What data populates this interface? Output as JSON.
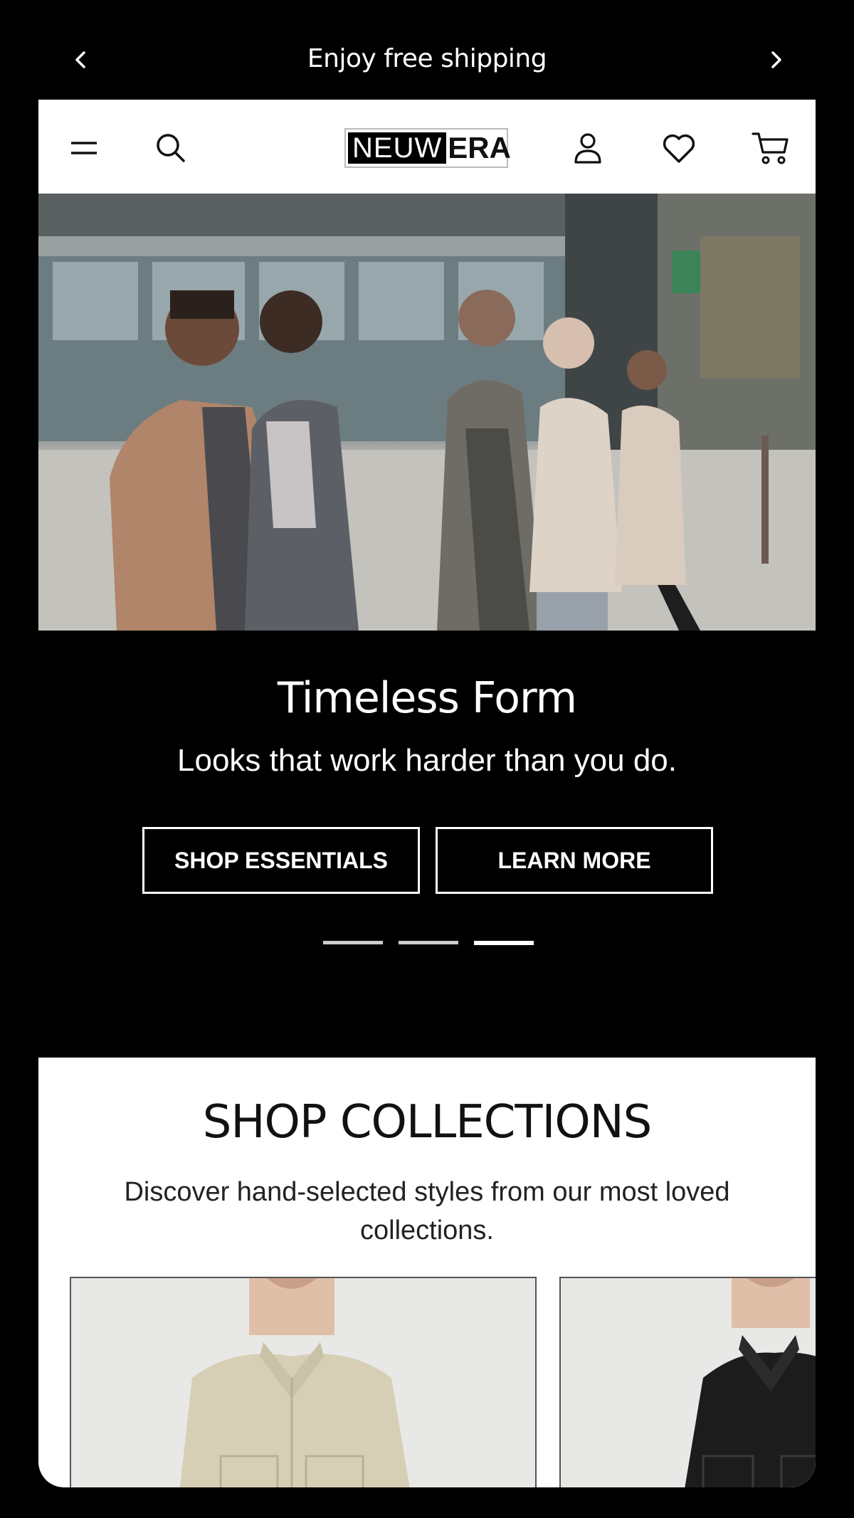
{
  "announcement": {
    "text": "Enjoy free shipping",
    "prev_icon": "chevron-left-icon",
    "next_icon": "chevron-right-icon"
  },
  "header": {
    "logo": {
      "part1": "NEUW",
      "part2": "ERA"
    },
    "icons": [
      "menu-icon",
      "search-icon",
      "account-icon",
      "heart-icon",
      "cart-icon"
    ]
  },
  "hero": {
    "image_alt": "group of people in coats walking in a city street",
    "title": "Timeless Form",
    "subtitle": "Looks that work harder than you do.",
    "primary_button": "SHOP ESSENTIALS",
    "secondary_button": "LEARN MORE",
    "slides_count": 3,
    "active_slide": 3
  },
  "collections": {
    "title": "SHOP COLLECTIONS",
    "description": "Discover hand-selected styles from our most loved collections.",
    "cards": [
      {
        "image_alt": "beige overshirt"
      },
      {
        "image_alt": "black overshirt"
      }
    ]
  },
  "colors": {
    "background": "#000000",
    "surface": "#ffffff",
    "text_dark": "#111111"
  }
}
